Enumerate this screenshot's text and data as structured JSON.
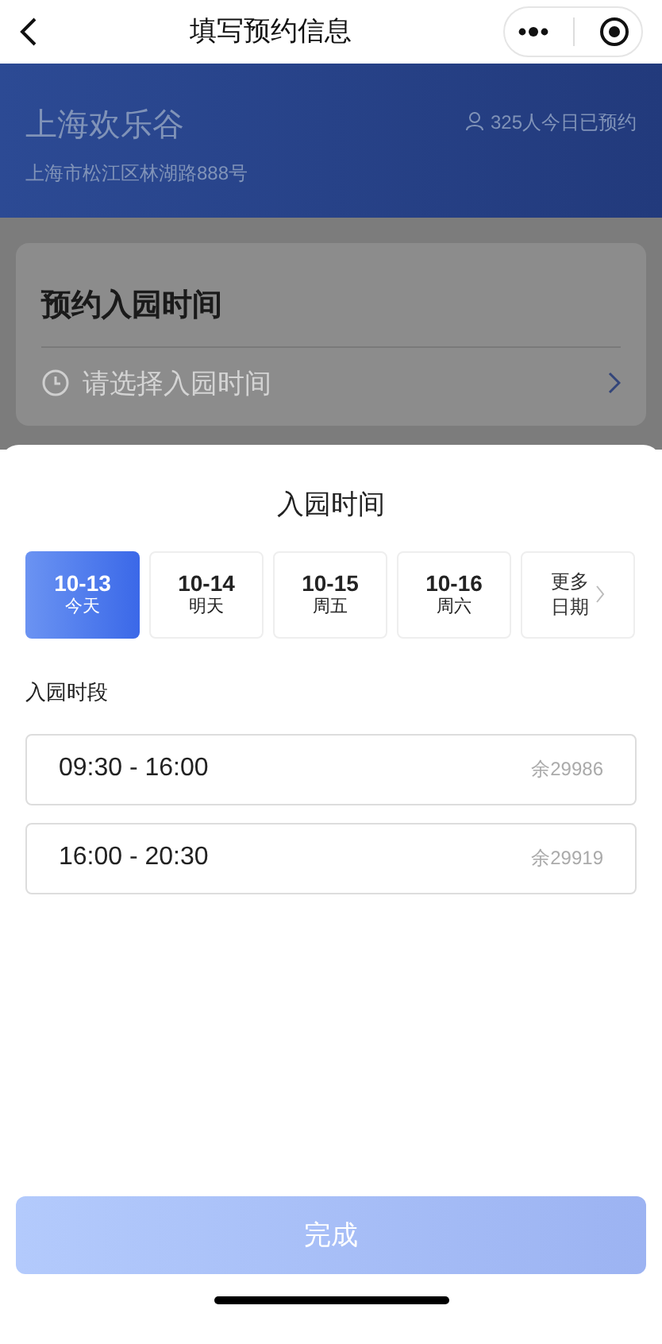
{
  "nav": {
    "title": "填写预约信息"
  },
  "park": {
    "name": "上海欢乐谷",
    "address": "上海市松江区林湖路888号",
    "booked": "325人今日已预约"
  },
  "booking_card": {
    "title": "预约入园时间",
    "placeholder": "请选择入园时间"
  },
  "sheet": {
    "title": "入园时间",
    "dates": [
      {
        "date": "10-13",
        "day": "今天",
        "selected": true
      },
      {
        "date": "10-14",
        "day": "明天",
        "selected": false
      },
      {
        "date": "10-15",
        "day": "周五",
        "selected": false
      },
      {
        "date": "10-16",
        "day": "周六",
        "selected": false
      }
    ],
    "more_dates": [
      "更多",
      "日期"
    ],
    "slots_label": "入园时段",
    "slots": [
      {
        "time": "09:30 - 16:00",
        "remaining": "余29986",
        "selected": false
      },
      {
        "time": "16:00 - 20:30",
        "remaining": "余29919",
        "selected": false
      }
    ],
    "done_button": {
      "label": "完成",
      "disabled": true
    }
  }
}
